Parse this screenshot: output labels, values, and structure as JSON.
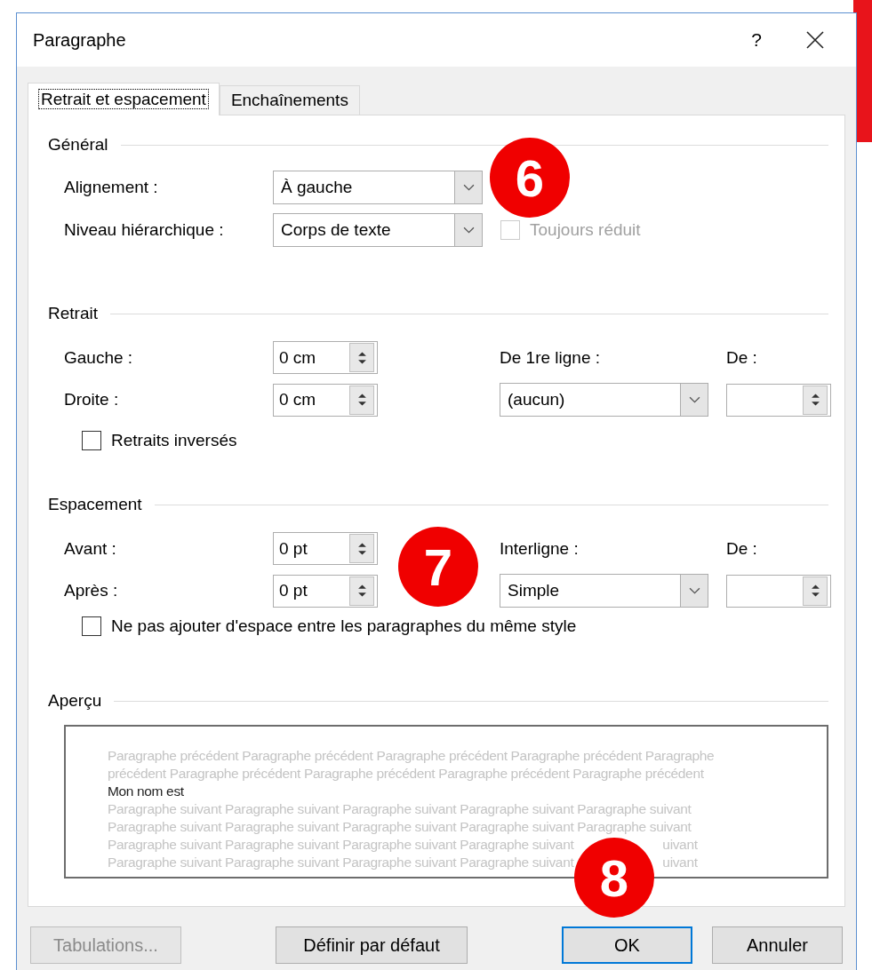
{
  "window": {
    "title": "Paragraphe",
    "help": "?"
  },
  "tabs": [
    {
      "label": "Retrait et espacement",
      "selected": true
    },
    {
      "label": "Enchaînements",
      "selected": false
    }
  ],
  "general": {
    "title": "Général",
    "alignment": {
      "label": "Alignement :",
      "value": "À gauche"
    },
    "outline_level": {
      "label": "Niveau hiérarchique :",
      "value": "Corps de texte"
    },
    "collapsed": {
      "label": "Toujours réduit",
      "checked": false,
      "disabled": true
    }
  },
  "indent": {
    "title": "Retrait",
    "left": {
      "label": "Gauche :",
      "value": "0 cm"
    },
    "right": {
      "label": "Droite :",
      "value": "0 cm"
    },
    "first_line": {
      "label": "De 1re ligne :",
      "value": "(aucun)"
    },
    "by": {
      "label": "De :"
    },
    "mirror": {
      "label": "Retraits inversés",
      "checked": false,
      "disabled": false
    }
  },
  "spacing": {
    "title": "Espacement",
    "before": {
      "label": "Avant :",
      "value": "0 pt"
    },
    "after": {
      "label": "Après :",
      "value": "0 pt"
    },
    "line_spacing": {
      "label": "Interligne :",
      "value": "Simple"
    },
    "at": {
      "label": "De :"
    },
    "dont_add": {
      "label": "Ne pas ajouter d'espace entre les paragraphes du même style",
      "checked": false,
      "disabled": false
    }
  },
  "preview": {
    "title": "Aperçu",
    "lines": [
      {
        "text": "Paragraphe précédent Paragraphe précédent Paragraphe précédent Paragraphe précédent Paragraphe",
        "kind": "other"
      },
      {
        "text": "précédent Paragraphe précédent Paragraphe précédent Paragraphe précédent Paragraphe précédent",
        "kind": "other"
      },
      {
        "text": "Mon nom est",
        "kind": "current"
      },
      {
        "text": "Paragraphe suivant Paragraphe suivant Paragraphe suivant Paragraphe suivant Paragraphe suivant",
        "kind": "other"
      },
      {
        "text": "Paragraphe suivant Paragraphe suivant Paragraphe suivant Paragraphe suivant Paragraphe suivant",
        "kind": "other"
      },
      {
        "text": "Paragraphe suivant Paragraphe suivant Paragraphe suivant Paragraphe suivant",
        "tail": "uivant",
        "kind": "other"
      },
      {
        "text": "Paragraphe suivant Paragraphe suivant Paragraphe suivant Paragraphe suivant",
        "tail": "uivant",
        "kind": "other"
      }
    ]
  },
  "buttons": [
    {
      "label": "Tabulations...",
      "disabled": true,
      "default": false
    },
    {
      "label": "Définir par défaut",
      "disabled": false,
      "default": false
    },
    {
      "label": "OK",
      "disabled": false,
      "default": true
    },
    {
      "label": "Annuler",
      "disabled": false,
      "default": false
    }
  ],
  "callouts": [
    "6",
    "7",
    "8"
  ]
}
